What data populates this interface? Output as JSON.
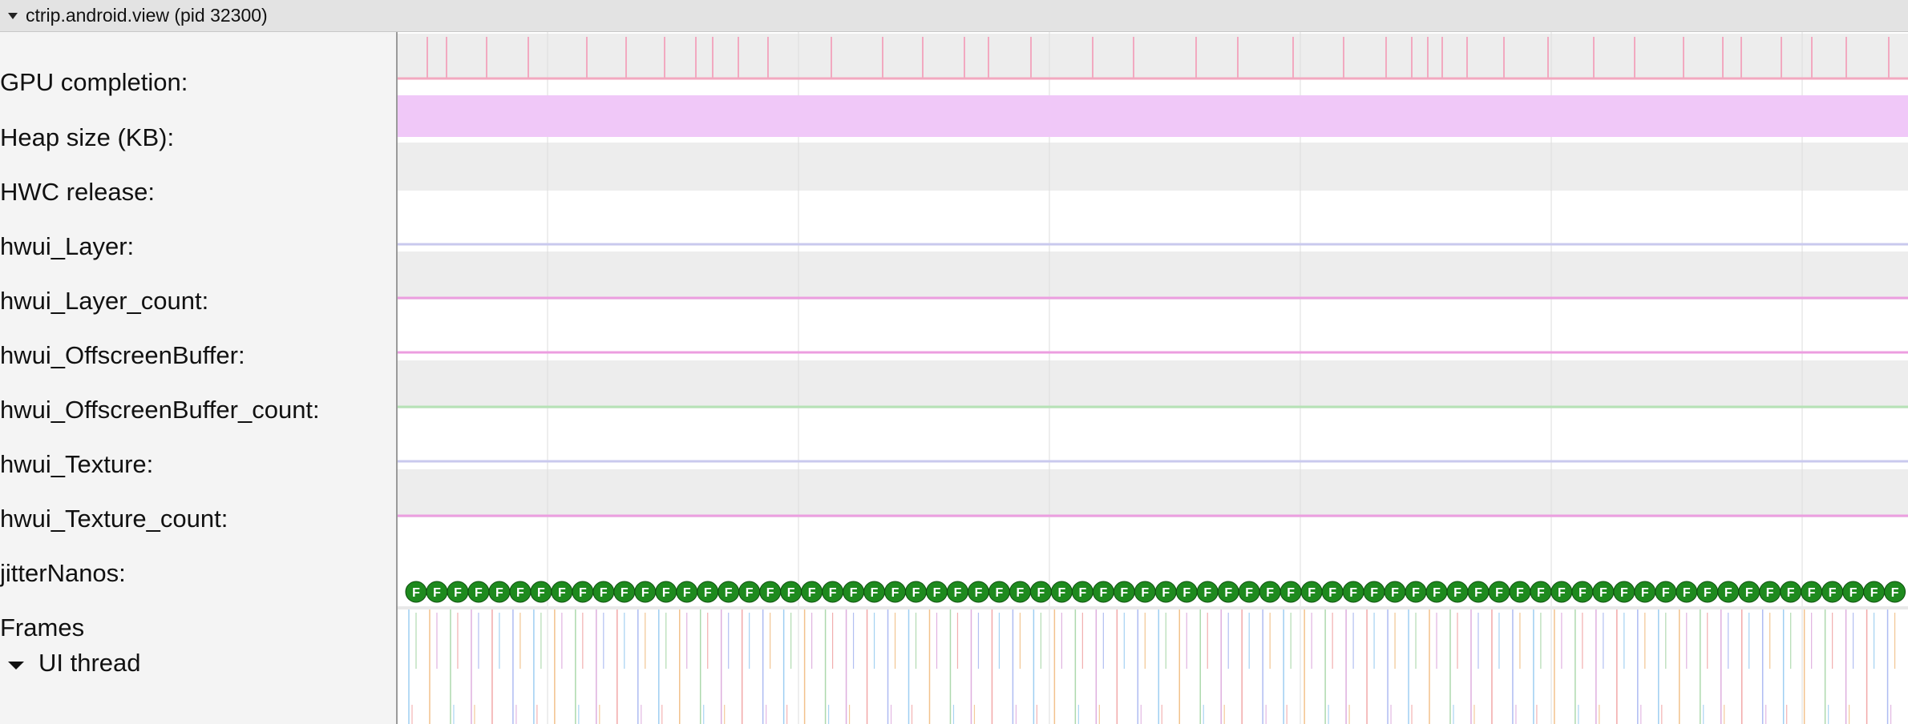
{
  "process": {
    "title": "ctrip.android.view (pid 32300)"
  },
  "tracks": [
    {
      "label": "GPU completion:"
    },
    {
      "label": "Heap size (KB):"
    },
    {
      "label": "HWC release:"
    },
    {
      "label": "hwui_Layer:"
    },
    {
      "label": "hwui_Layer_count:"
    },
    {
      "label": "hwui_OffscreenBuffer:"
    },
    {
      "label": "hwui_OffscreenBuffer_count:"
    },
    {
      "label": "hwui_Texture:"
    },
    {
      "label": "hwui_Texture_count:"
    },
    {
      "label": "jitterNanos:"
    },
    {
      "label": "Frames"
    }
  ],
  "ui_thread": {
    "label": "UI thread"
  },
  "frame_marker": {
    "letter": "F",
    "color": "#1e8a1e",
    "count": 72
  },
  "colors": {
    "gpu_tick": "#f2a9c0",
    "heap_fill": "#f0c8f8",
    "hwui_layer_line": "#c9c9ee",
    "pink_line": "#ec9ee0",
    "green_line": "#b6e2b6",
    "track_gray": "#ededed",
    "grid_line": "#dddddd"
  }
}
